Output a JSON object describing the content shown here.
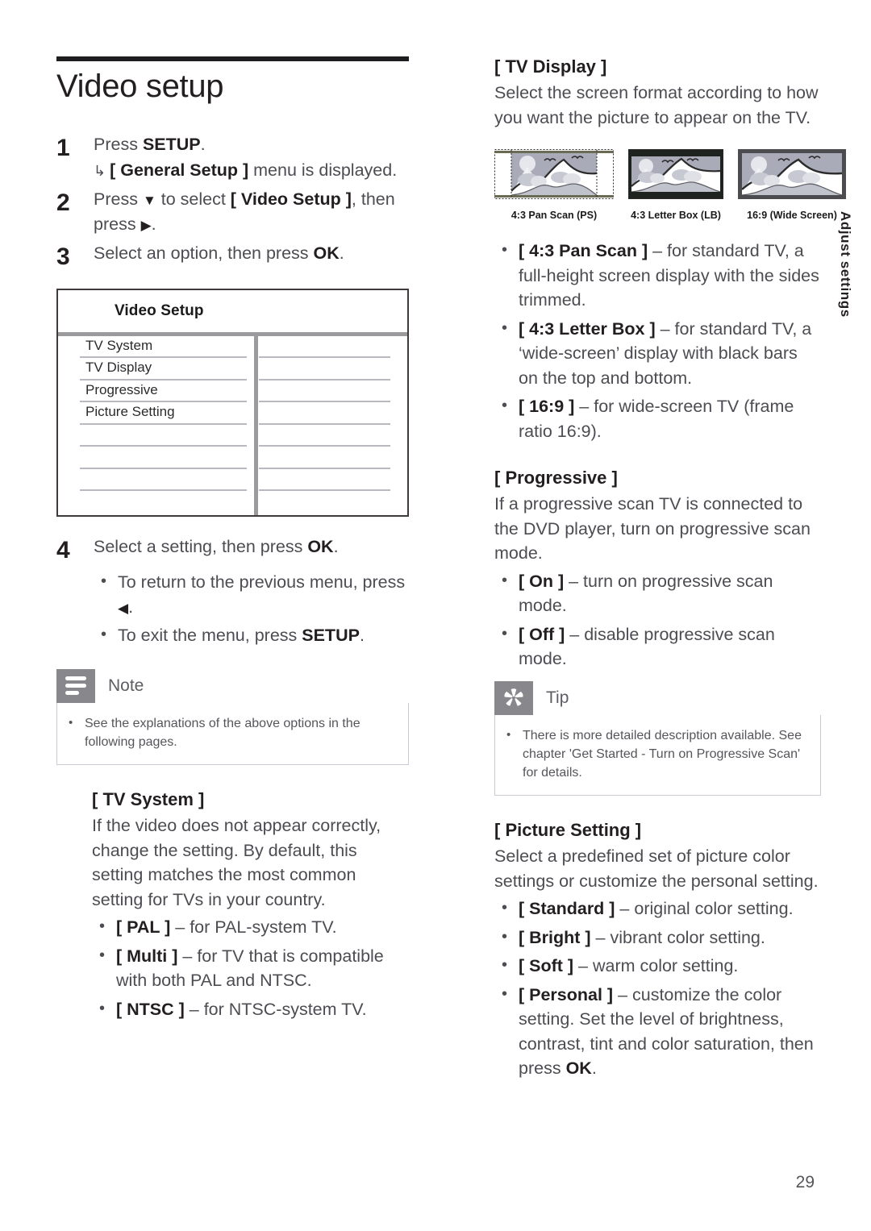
{
  "page": {
    "title": "Video setup",
    "number": "29",
    "side_tab": "Adjust settings"
  },
  "steps": [
    {
      "num": "1",
      "text_a": "Press ",
      "bold_a": "SETUP",
      "text_b": ".",
      "sub_arrow": "↳",
      "sub_bold": "[ General Setup ]",
      "sub_text": " menu is displayed."
    },
    {
      "num": "2",
      "text_a": "Press ",
      "glyph_a": "▼",
      "text_b": " to select ",
      "bold_a": "[ Video Setup ]",
      "text_c": ", then press ",
      "glyph_b": "▶",
      "text_d": "."
    },
    {
      "num": "3",
      "text_a": "Select an option, then press ",
      "bold_a": "OK",
      "text_b": "."
    },
    {
      "num": "4",
      "text_a": "Select a setting, then press ",
      "bold_a": "OK",
      "text_b": "."
    }
  ],
  "step4_bullets": [
    {
      "dot": "•",
      "text_a": "To return to the previous menu, press ",
      "glyph": "◀",
      "text_b": "."
    },
    {
      "dot": "•",
      "text_a": "To exit the menu, press ",
      "bold": "SETUP",
      "text_b": "."
    }
  ],
  "osd_menu": {
    "title": "Video Setup",
    "items": [
      "TV System",
      "TV Display",
      "Progressive",
      "Picture Setting",
      "",
      "",
      "",
      ""
    ]
  },
  "note_callout": {
    "icon": "note-lines-icon",
    "label": "Note",
    "bullet_dot": "•",
    "text": "See the explanations of the above options in the following pages."
  },
  "tip_callout": {
    "icon": "star-icon",
    "label": "Tip",
    "bullet_dot": "•",
    "text": "There is more detailed description available. See chapter 'Get Started - Turn on Progressive Scan' for details."
  },
  "tv_system": {
    "heading": "[ TV System ]",
    "paragraph": "If the video does not appear correctly, change the setting. By default, this setting matches the most common setting for TVs in your country.",
    "bullets": [
      {
        "dot": "•",
        "bold": "[ PAL ]",
        "text": " – for PAL-system TV."
      },
      {
        "dot": "•",
        "bold": "[ Multi ]",
        "text": " – for TV that is compatible with both PAL and NTSC."
      },
      {
        "dot": "•",
        "bold": "[ NTSC ]",
        "text": " – for NTSC-system TV."
      }
    ]
  },
  "tv_display": {
    "heading": "[ TV Display ]",
    "paragraph": "Select the screen format according to how you want the picture to appear on the TV.",
    "figures": [
      {
        "caption": "4:3 Pan Scan (PS)",
        "kind": "pan-scan"
      },
      {
        "caption": "4:3 Letter Box (LB)",
        "kind": "letter-box"
      },
      {
        "caption": "16:9 (Wide Screen)",
        "kind": "wide-screen"
      }
    ],
    "bullets": [
      {
        "dot": "•",
        "bold": "[ 4:3 Pan Scan ]",
        "text": " – for standard TV, a full-height screen display with the sides trimmed."
      },
      {
        "dot": "•",
        "bold": "[ 4:3 Letter Box ]",
        "text": " – for standard TV,  a ‘wide-screen’ display with black bars on the top and bottom."
      },
      {
        "dot": "•",
        "bold": "[ 16:9 ]",
        "text": " – for wide-screen TV (frame ratio 16:9)."
      }
    ]
  },
  "progressive": {
    "heading": "[ Progressive ]",
    "paragraph": "If a progressive scan TV is connected to the DVD player, turn on progressive scan mode.",
    "bullets": [
      {
        "dot": "•",
        "bold": "[ On ]",
        "text": " – turn on progressive scan mode."
      },
      {
        "dot": "•",
        "bold": "[ Off ]",
        "text": " – disable progressive scan mode."
      }
    ]
  },
  "picture_setting": {
    "heading": "[ Picture Setting ]",
    "paragraph": "Select a predefined set of picture color settings or customize the personal setting.",
    "bullets": [
      {
        "dot": "•",
        "bold": "[ Standard ]",
        "text": " – original color setting."
      },
      {
        "dot": "•",
        "bold": "[ Bright ]",
        "text": " – vibrant color setting."
      },
      {
        "dot": "•",
        "bold": "[ Soft ]",
        "text": " – warm color setting."
      },
      {
        "dot": "•",
        "bold": "[ Personal ]",
        "text_a": " – customize the color setting. Set the level of brightness, contrast, tint and color saturation, then press ",
        "bold_b": "OK",
        "text_b": "."
      }
    ]
  },
  "colors": {
    "rule": "#1d1d1f",
    "callout_icon_bg": "#87878c",
    "osd_border": "#403a3a",
    "osd_divider": "#9b9b9e",
    "sky": "#a9acb8"
  }
}
